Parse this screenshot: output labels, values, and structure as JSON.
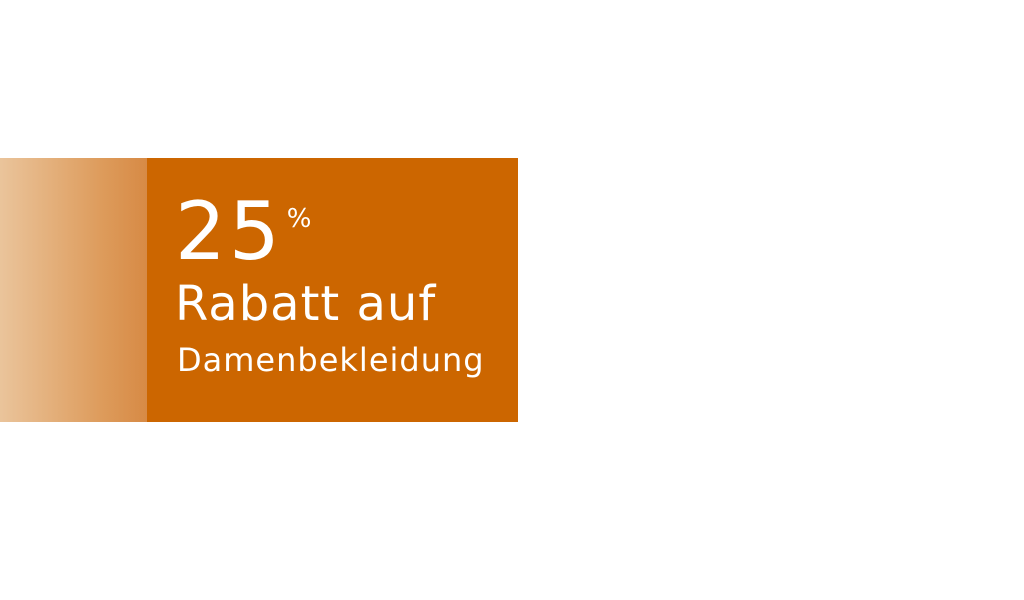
{
  "banner": {
    "percent_value": "25",
    "percent_sign": "%",
    "headline": "Rabatt auf",
    "subline": "Damenbekleidung",
    "colors": {
      "main": "#cc6600",
      "fade_start": "#eac49b",
      "fade_end": "#d78a45",
      "text": "#ffffff"
    }
  }
}
